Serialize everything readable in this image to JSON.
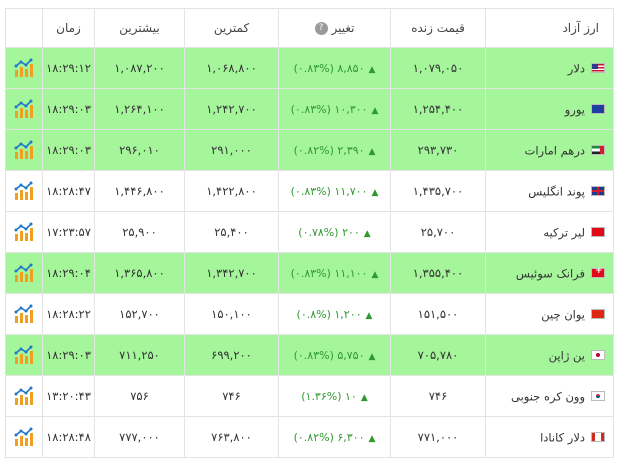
{
  "headers": {
    "name": "ارز آزاد",
    "live": "قیمت زنده",
    "change": "تغییر",
    "low": "کمترین",
    "high": "بیشترین",
    "time": "زمان"
  },
  "colors": {
    "highlight": "#a5f59b",
    "up": "#2e9a2e"
  },
  "rows": [
    {
      "name": "دلار",
      "flag": "us",
      "live": "۱,۰۷۹,۰۵۰",
      "change": "۸,۸۵۰ (۰.۸۳%)",
      "low": "۱,۰۶۸,۸۰۰",
      "high": "۱,۰۸۷,۲۰۰",
      "time": "۱۸:۲۹:۱۲",
      "hl": true
    },
    {
      "name": "یورو",
      "flag": "eu",
      "live": "۱,۲۵۴,۴۰۰",
      "change": "۱۰,۳۰۰ (۰.۸۳%)",
      "low": "۱,۲۴۲,۷۰۰",
      "high": "۱,۲۶۴,۱۰۰",
      "time": "۱۸:۲۹:۰۳",
      "hl": true
    },
    {
      "name": "درهم امارات",
      "flag": "ae",
      "live": "۲۹۳,۷۳۰",
      "change": "۲,۳۹۰ (۰.۸۲%)",
      "low": "۲۹۱,۰۰۰",
      "high": "۲۹۶,۰۱۰",
      "time": "۱۸:۲۹:۰۳",
      "hl": true
    },
    {
      "name": "پوند انگلیس",
      "flag": "gb",
      "live": "۱,۴۳۵,۷۰۰",
      "change": "۱۱,۷۰۰ (۰.۸۳%)",
      "low": "۱,۴۲۲,۸۰۰",
      "high": "۱,۴۴۶,۸۰۰",
      "time": "۱۸:۲۸:۴۷",
      "hl": false
    },
    {
      "name": "لیر ترکیه",
      "flag": "tr",
      "live": "۲۵,۷۰۰",
      "change": "۲۰۰ (۰.۷۸%)",
      "low": "۲۵,۴۰۰",
      "high": "۲۵,۹۰۰",
      "time": "۱۷:۲۳:۵۷",
      "hl": false
    },
    {
      "name": "فرانک سوئیس",
      "flag": "ch",
      "live": "۱,۳۵۵,۴۰۰",
      "change": "۱۱,۱۰۰ (۰.۸۳%)",
      "low": "۱,۳۴۲,۷۰۰",
      "high": "۱,۳۶۵,۸۰۰",
      "time": "۱۸:۲۹:۰۴",
      "hl": true
    },
    {
      "name": "یوان چین",
      "flag": "cn",
      "live": "۱۵۱,۵۰۰",
      "change": "۱,۲۰۰ (۰.۸%)",
      "low": "۱۵۰,۱۰۰",
      "high": "۱۵۲,۷۰۰",
      "time": "۱۸:۲۸:۲۲",
      "hl": false
    },
    {
      "name": "ین ژاپن",
      "flag": "jp",
      "live": "۷۰۵,۷۸۰",
      "change": "۵,۷۵۰ (۰.۸۳%)",
      "low": "۶۹۹,۲۰۰",
      "high": "۷۱۱,۲۵۰",
      "time": "۱۸:۲۹:۰۳",
      "hl": true
    },
    {
      "name": "وون کره جنوبی",
      "flag": "kr",
      "live": "۷۴۶",
      "change": "۱۰ (۱.۳۶%)",
      "low": "۷۴۶",
      "high": "۷۵۶",
      "time": "۱۳:۲۰:۴۳",
      "hl": false
    },
    {
      "name": "دلار کانادا",
      "flag": "ca",
      "live": "۷۷۱,۰۰۰",
      "change": "۶,۳۰۰ (۰.۸۲%)",
      "low": "۷۶۳,۸۰۰",
      "high": "۷۷۷,۰۰۰",
      "time": "۱۸:۲۸:۴۸",
      "hl": false
    }
  ]
}
